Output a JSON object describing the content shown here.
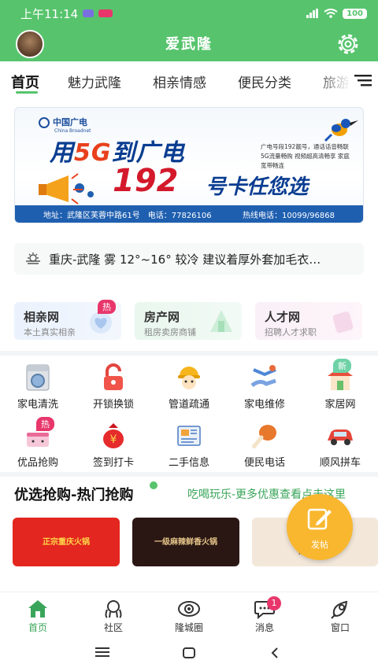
{
  "status_bar": {
    "time": "上午11:14",
    "battery": "100"
  },
  "header": {
    "title": "爱武隆"
  },
  "tabs": [
    {
      "label": "首页"
    },
    {
      "label": "魅力武隆"
    },
    {
      "label": "相亲情感"
    },
    {
      "label": "便民分类"
    },
    {
      "label": "旅游"
    }
  ],
  "banner": {
    "logo": "中国广电",
    "logo_sub": "China Broadnet",
    "headline_a": "用",
    "headline_5g": "5G",
    "headline_b": "到广电",
    "number": "192",
    "slogan": "号卡任您选",
    "details": "广电号段192靓号，通话话音畅联 5G流量畅购 视频超高清畅享 家庭宽带畅连",
    "address": "地址：武隆区芙蓉中路61号",
    "phone": "电话：77826106",
    "hotline": "热线电话：10099/96868"
  },
  "weather": {
    "text": "重庆-武隆 雾 12°~16° 较冷 建议着厚外套加毛衣…"
  },
  "cards": [
    {
      "title": "相亲网",
      "subtitle": "本土真实相亲",
      "badge": "热"
    },
    {
      "title": "房产网",
      "subtitle": "租房卖房商铺"
    },
    {
      "title": "人才网",
      "subtitle": "招聘人才求职"
    }
  ],
  "grid": [
    {
      "label": "家电清洗",
      "icon": "washing-machine-icon"
    },
    {
      "label": "开锁换锁",
      "icon": "lock-icon"
    },
    {
      "label": "管道疏通",
      "icon": "worker-icon"
    },
    {
      "label": "家电维修",
      "icon": "wrench-icon"
    },
    {
      "label": "家居网",
      "icon": "house-icon",
      "badge": "新"
    },
    {
      "label": "优品抢购",
      "icon": "cake-icon",
      "badge": "热"
    },
    {
      "label": "签到打卡",
      "icon": "money-bag-icon"
    },
    {
      "label": "二手信息",
      "icon": "newspaper-icon"
    },
    {
      "label": "便民电话",
      "icon": "chicken-leg-icon"
    },
    {
      "label": "顺风拼车",
      "icon": "car-icon"
    }
  ],
  "section": {
    "title": "优选抢购-热门抢购",
    "more": "吃喝玩乐-更多优惠查看点击这里"
  },
  "promos": [
    {
      "text": "正宗重庆火锅"
    },
    {
      "text": "一级麻辣鲜香火锅"
    },
    {
      "text": "仙林 养生"
    }
  ],
  "fab": {
    "label": "发帖"
  },
  "bottom_nav": [
    {
      "label": "首页"
    },
    {
      "label": "社区"
    },
    {
      "label": "隆城圈"
    },
    {
      "label": "消息",
      "badge": "1"
    },
    {
      "label": "窗口"
    }
  ],
  "colors": {
    "brand_green": "#57c46d",
    "accent_red": "#e8366b",
    "fab_orange": "#f8b72f"
  }
}
